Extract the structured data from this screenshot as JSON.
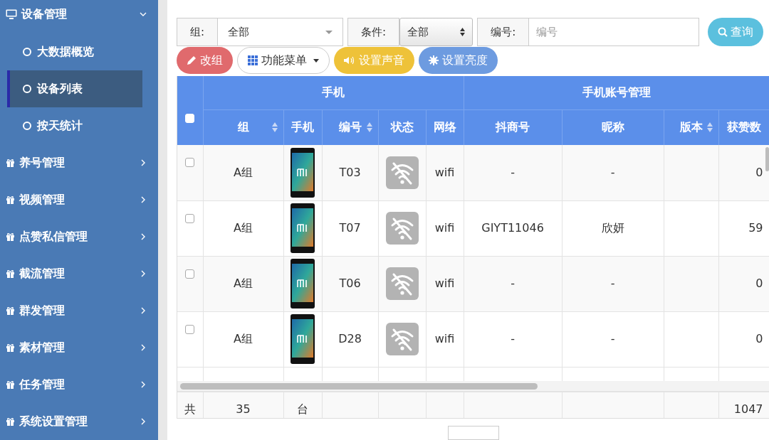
{
  "sidebar": {
    "items": [
      {
        "label": "设备管理",
        "expanded": true,
        "children": [
          {
            "label": "大数据概览",
            "selected": false
          },
          {
            "label": "设备列表",
            "selected": true
          },
          {
            "label": "按天统计",
            "selected": false
          }
        ]
      },
      {
        "label": "养号管理",
        "expanded": false
      },
      {
        "label": "视频管理",
        "expanded": false
      },
      {
        "label": "点赞私信管理",
        "expanded": false
      },
      {
        "label": "截流管理",
        "expanded": false
      },
      {
        "label": "群发管理",
        "expanded": false
      },
      {
        "label": "素材管理",
        "expanded": false
      },
      {
        "label": "任务管理",
        "expanded": false
      },
      {
        "label": "系统设置管理",
        "expanded": false
      }
    ]
  },
  "filters": [
    {
      "label": "组:",
      "kind": "dropdown",
      "value": "全部"
    },
    {
      "label": "条件:",
      "kind": "spinner",
      "value": "全部"
    },
    {
      "label": "编号:",
      "kind": "input",
      "placeholder": "编号"
    }
  ],
  "search_button": "查询",
  "actions": [
    {
      "label": "改组",
      "kind": "edit"
    },
    {
      "label": "功能菜单",
      "kind": "menu"
    },
    {
      "label": "设置声音",
      "kind": "sound"
    },
    {
      "label": "设置亮度",
      "kind": "brightness"
    }
  ],
  "table": {
    "header_checked": false,
    "groups": [
      "手机",
      "手机账号管理"
    ],
    "columns": [
      {
        "label": "组",
        "sortable": true
      },
      {
        "label": "手机",
        "sortable": false
      },
      {
        "label": "编号",
        "sortable": true
      },
      {
        "label": "状态",
        "sortable": false
      },
      {
        "label": "网络",
        "sortable": false
      },
      {
        "label": "抖商号",
        "sortable": false
      },
      {
        "label": "昵称",
        "sortable": false
      },
      {
        "label": "版本",
        "sortable": true
      },
      {
        "label": "获赞数",
        "sortable": false
      }
    ],
    "rows": [
      {
        "checked": false,
        "group": "A组",
        "code": "T03",
        "online": false,
        "network": "wifi",
        "account": "-",
        "nickname": "-",
        "likes": "0"
      },
      {
        "checked": false,
        "group": "A组",
        "code": "T07",
        "online": false,
        "network": "wifi",
        "account": "GIYT11046",
        "nickname": "欣妍",
        "likes": "59"
      },
      {
        "checked": false,
        "group": "A组",
        "code": "T06",
        "online": false,
        "network": "wifi",
        "account": "-",
        "nickname": "-",
        "likes": "0"
      },
      {
        "checked": false,
        "group": "A组",
        "code": "D28",
        "online": false,
        "network": "wifi",
        "account": "-",
        "nickname": "-",
        "likes": "0"
      }
    ],
    "footer": {
      "label": "共",
      "count": "35",
      "unit": "台",
      "likes": "1047"
    }
  }
}
